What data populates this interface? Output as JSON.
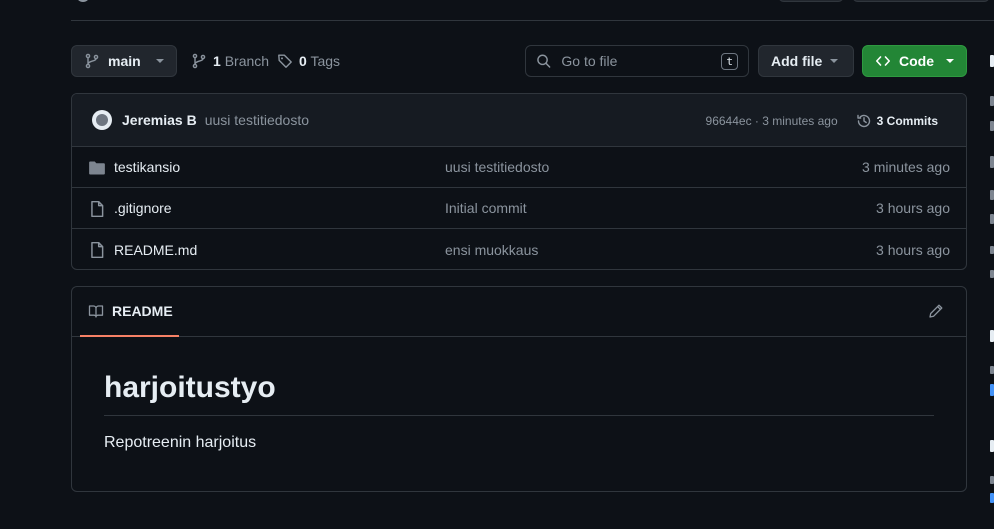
{
  "toolbar": {
    "branch_label": "main",
    "branch_count": "1",
    "branch_word": "Branch",
    "tag_count": "0",
    "tag_word": "Tags",
    "search_placeholder": "Go to file",
    "search_shortcut": "t",
    "add_file_label": "Add file",
    "code_label": "Code"
  },
  "latest_commit": {
    "author": "Jeremias B",
    "message": "uusi testitiedosto",
    "sha_time": "96644ec · 3 minutes ago",
    "commits_count": "3",
    "commits_word": "Commits"
  },
  "files": [
    {
      "name": "testikansio",
      "type": "folder",
      "commit": "uusi testitiedosto",
      "time": "3 minutes ago"
    },
    {
      "name": ".gitignore",
      "type": "file",
      "commit": "Initial commit",
      "time": "3 hours ago"
    },
    {
      "name": "README.md",
      "type": "file",
      "commit": "ensi muokkaus",
      "time": "3 hours ago"
    }
  ],
  "readme": {
    "tab_label": "README",
    "title": "harjoitustyo",
    "text": "Repotreenin harjoitus"
  },
  "colors": {
    "background": "#0d1117",
    "border": "#30363d",
    "code_button": "#238636",
    "tab_underline": "#f78166",
    "muted_text": "#8b949e"
  }
}
